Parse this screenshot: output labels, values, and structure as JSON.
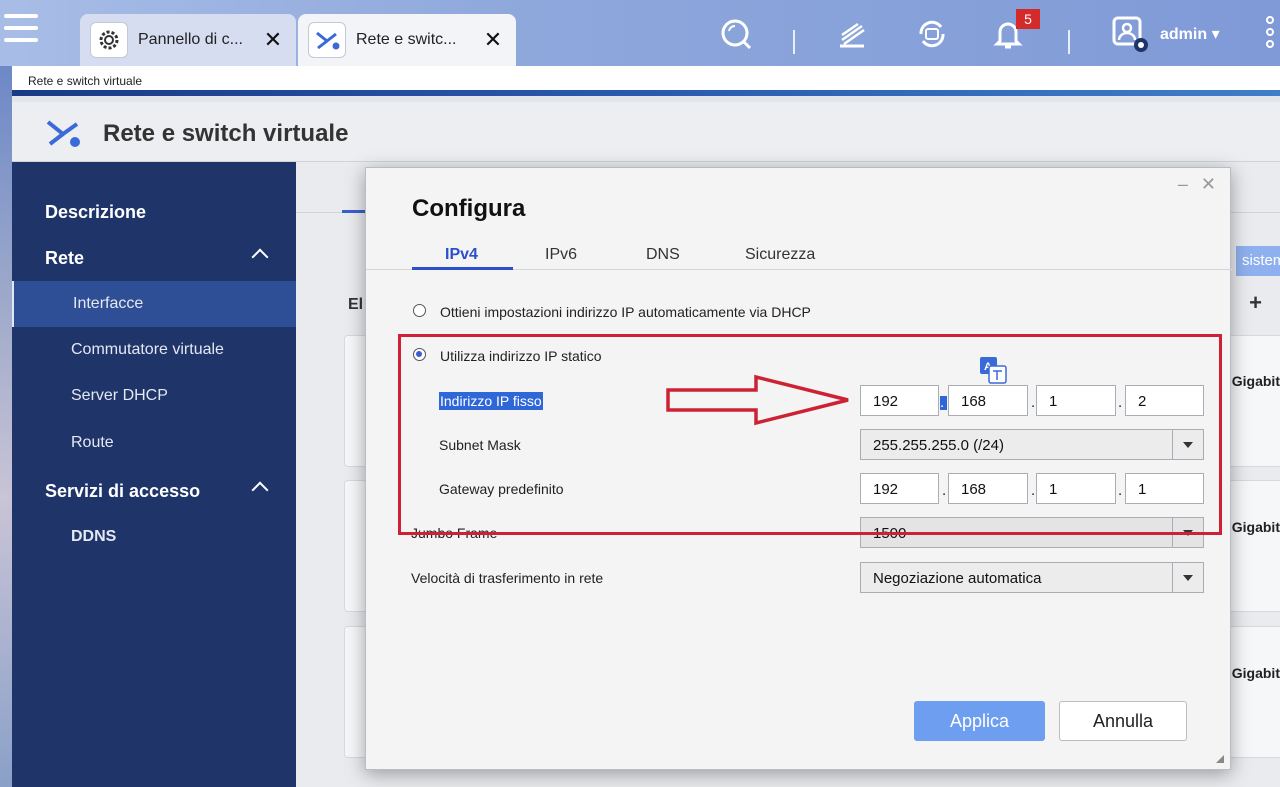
{
  "taskbar": {
    "tabs": [
      {
        "label": "Pannello di c...",
        "icon": "gear-icon"
      },
      {
        "label": "Rete e switc...",
        "icon": "network-switch-icon"
      }
    ],
    "notification_count": "5",
    "user": "admin ▾"
  },
  "app": {
    "breadcrumb": "Rete e switch virtuale",
    "title": "Rete e switch virtuale"
  },
  "sidebar": {
    "items": [
      {
        "label": "Descrizione"
      },
      {
        "label": "Rete"
      },
      {
        "label": "Interfacce"
      },
      {
        "label": "Commutatore virtuale"
      },
      {
        "label": "Server DHCP"
      },
      {
        "label": "Route"
      },
      {
        "label": "Servizi di accesso"
      },
      {
        "label": "DDNS"
      }
    ]
  },
  "background": {
    "el_label": "El",
    "sistem_label": "sistem",
    "gigabit_label": "Gigabit",
    "plus": "+"
  },
  "dialog": {
    "window_controls": "– ✕",
    "title": "Configura",
    "tabs": [
      "IPv4",
      "IPv6",
      "DNS",
      "Sicurezza"
    ],
    "dhcp_option": "Ottieni impostazioni indirizzo IP automaticamente via DHCP",
    "static_option": "Utilizza indirizzo IP statico",
    "fixed_ip": {
      "label": "Indirizzo IP fisso",
      "octets": [
        "192",
        "168",
        "1",
        "2"
      ]
    },
    "subnet_mask": {
      "label": "Subnet Mask",
      "value": "255.255.255.0 (/24)"
    },
    "gateway": {
      "label": "Gateway predefinito",
      "octets": [
        "192",
        "168",
        "1",
        "1"
      ]
    },
    "jumbo_frame": {
      "label": "Jumbo Frame",
      "value": "1500"
    },
    "speed": {
      "label": "Velocità di trasferimento in rete",
      "value": "Negoziazione automatica"
    },
    "apply_label": "Applica",
    "cancel_label": "Annulla"
  },
  "colors": {
    "accent": "#2b4fc8",
    "sidebar": "#1f3469",
    "annotation": "#cc2233"
  }
}
